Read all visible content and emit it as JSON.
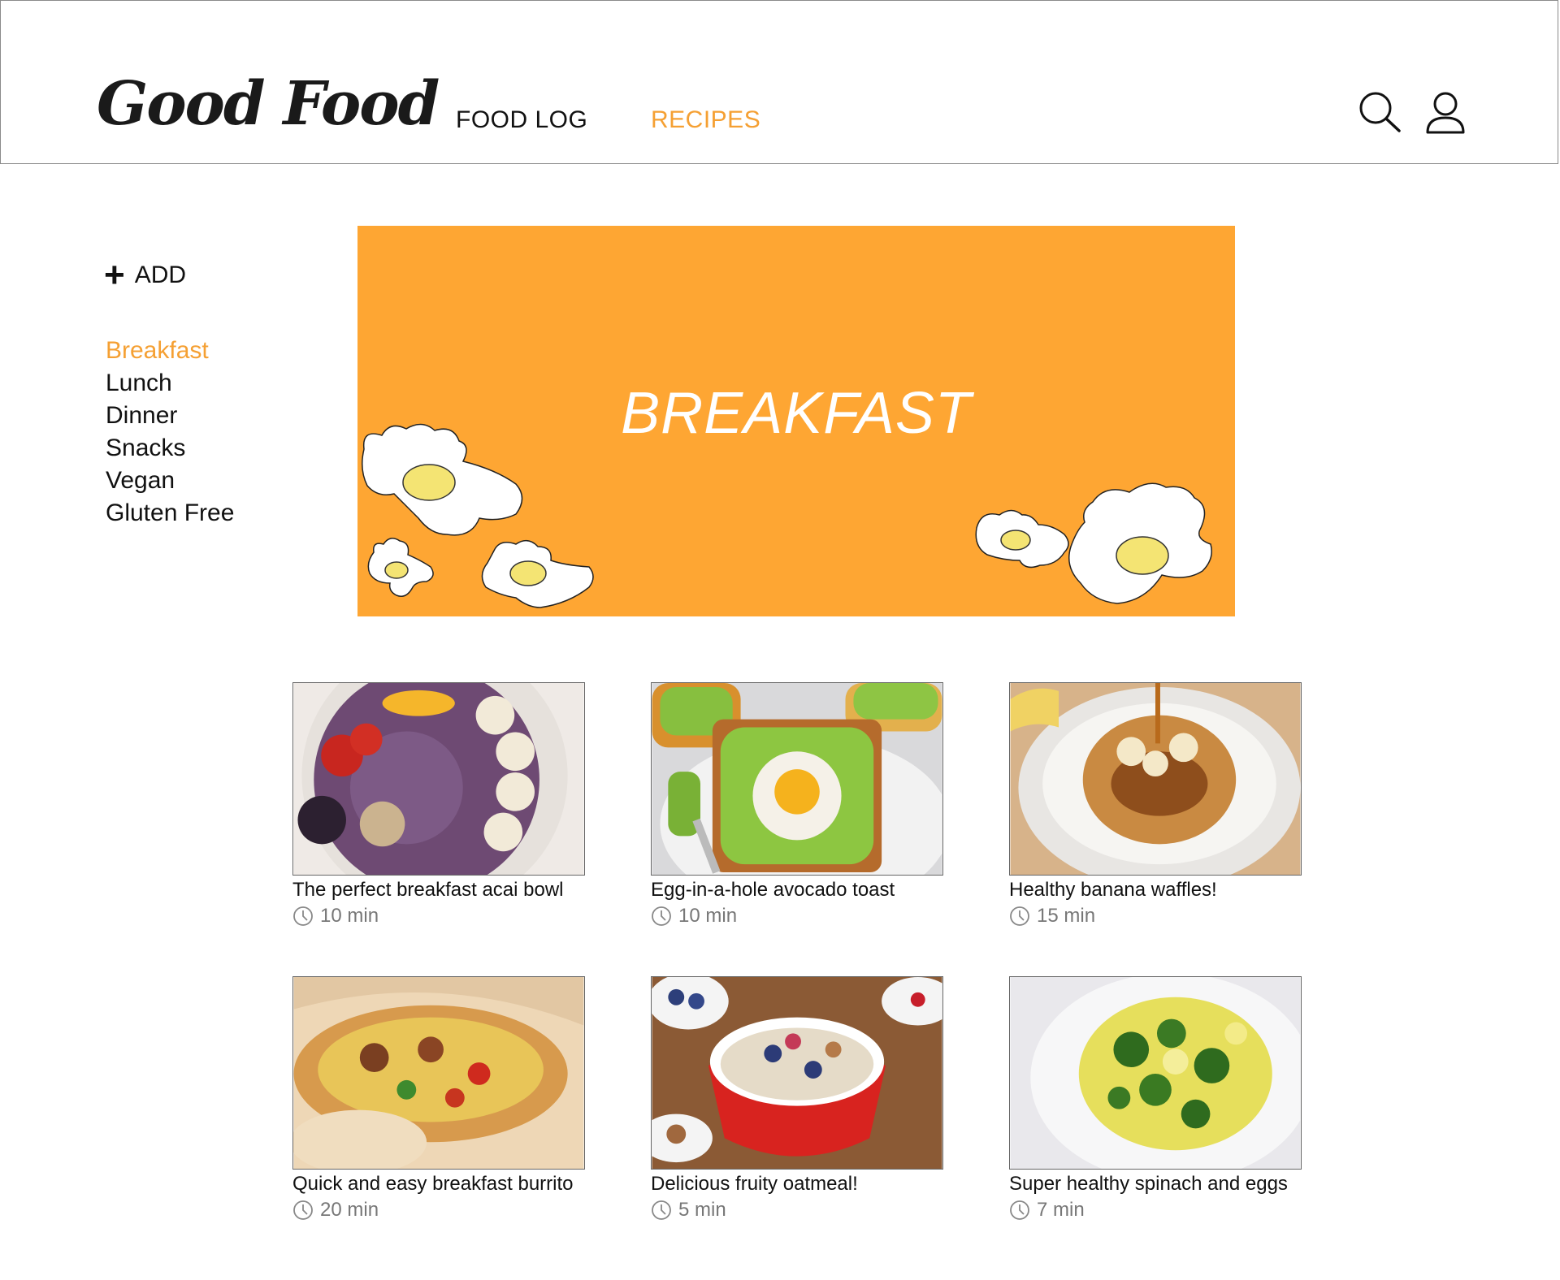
{
  "header": {
    "logo": "Good Food",
    "nav": [
      {
        "label": "FOOD LOG",
        "active": false
      },
      {
        "label": "RECIPES",
        "active": true
      }
    ],
    "icons": [
      "search-icon",
      "user-icon"
    ],
    "accent_color": "#f5a033"
  },
  "sidebar": {
    "add_label": "ADD",
    "categories": [
      "Breakfast",
      "Lunch",
      "Dinner",
      "Snacks",
      "Vegan",
      "Gluten Free"
    ],
    "active_category": "Breakfast"
  },
  "banner": {
    "title": "BREAKFAST",
    "bg_color": "#fea633"
  },
  "recipes": [
    {
      "title": "The perfect breakfast acai bowl",
      "time": "10 min"
    },
    {
      "title": "Egg-in-a-hole avocado toast",
      "time": "10 min"
    },
    {
      "title": "Healthy banana waffles!",
      "time": "15 min"
    },
    {
      "title": "Quick and easy breakfast burrito",
      "time": "20 min"
    },
    {
      "title": "Delicious fruity oatmeal!",
      "time": "5 min"
    },
    {
      "title": "Super healthy spinach and eggs",
      "time": "7 min"
    }
  ]
}
